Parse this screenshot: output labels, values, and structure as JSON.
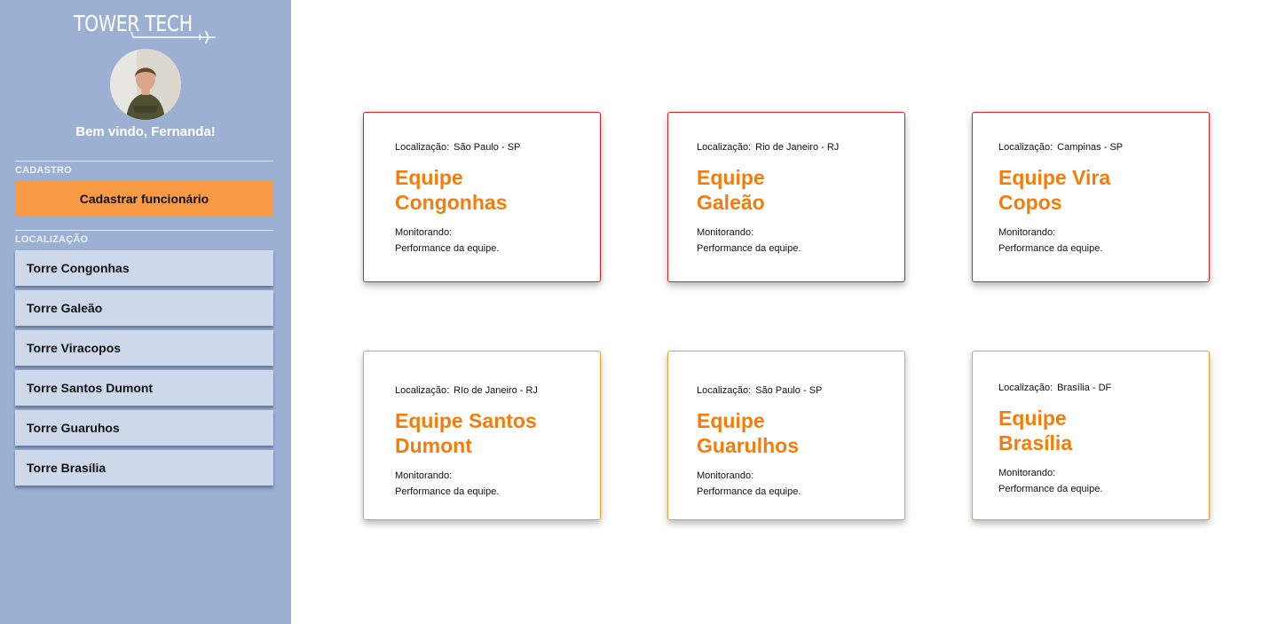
{
  "brand": {
    "name": "TOWER TECH"
  },
  "user": {
    "welcome": "Bem vindo, Fernanda!"
  },
  "sidebar": {
    "cadastro_label": "CADASTRO",
    "register_button": "Cadastrar funcionário",
    "localizacao_label": "LOCALIZAÇÃO",
    "towers": [
      {
        "label": "Torre Congonhas"
      },
      {
        "label": "Torre Galeão"
      },
      {
        "label": "Torre Viracopos"
      },
      {
        "label": "Torre Santos Dumont"
      },
      {
        "label": "Torre Guaruhos"
      },
      {
        "label": "Torre Brasília"
      }
    ]
  },
  "cards": [
    {
      "loc_label": "Localização:",
      "location": "São Paulo - SP",
      "title_1": "Equipe",
      "title_2": "Congonhas",
      "mon_1": "Monitorando:",
      "mon_2": "Performance da equipe.",
      "status": "critical"
    },
    {
      "loc_label": "Localização:",
      "location": "Rio de Janeiro - RJ",
      "title_1": "Equipe",
      "title_2": "Galeão",
      "mon_1": "Monitorando:",
      "mon_2": "Performance da equipe.",
      "status": "critical"
    },
    {
      "loc_label": "Localização:",
      "location": "Campinas - SP",
      "title_1": "Equipe Vira",
      "title_2": "Copos",
      "mon_1": "Monitorando:",
      "mon_2": "Performance da equipe.",
      "status": "critical"
    },
    {
      "loc_label": "Localização:",
      "location": "RIo de Janeiro - RJ",
      "title_1": "Equipe Santos",
      "title_2": "Dumont",
      "mon_1": "Monitorando:",
      "mon_2": "Performance da equipe.",
      "status": "warning"
    },
    {
      "loc_label": "Localização:",
      "location": "São Paulo - SP",
      "title_1": "Equipe",
      "title_2": "Guarulhos",
      "mon_1": "Monitorando:",
      "mon_2": "Performance da equipe.",
      "status": "warning"
    },
    {
      "loc_label": "Localização:",
      "location": "Brasília - DF",
      "title_1": "Equipe",
      "title_2": "Brasília",
      "mon_1": "Monitorando:",
      "mon_2": "Performance da equipe.",
      "status": "warning"
    }
  ],
  "colors": {
    "sidebar_bg": "#9cb0d4",
    "accent_orange": "#f99b45",
    "title_orange": "#f57c0a",
    "critical_border": "#e11d1d",
    "warning_border": "#f0a12c"
  }
}
